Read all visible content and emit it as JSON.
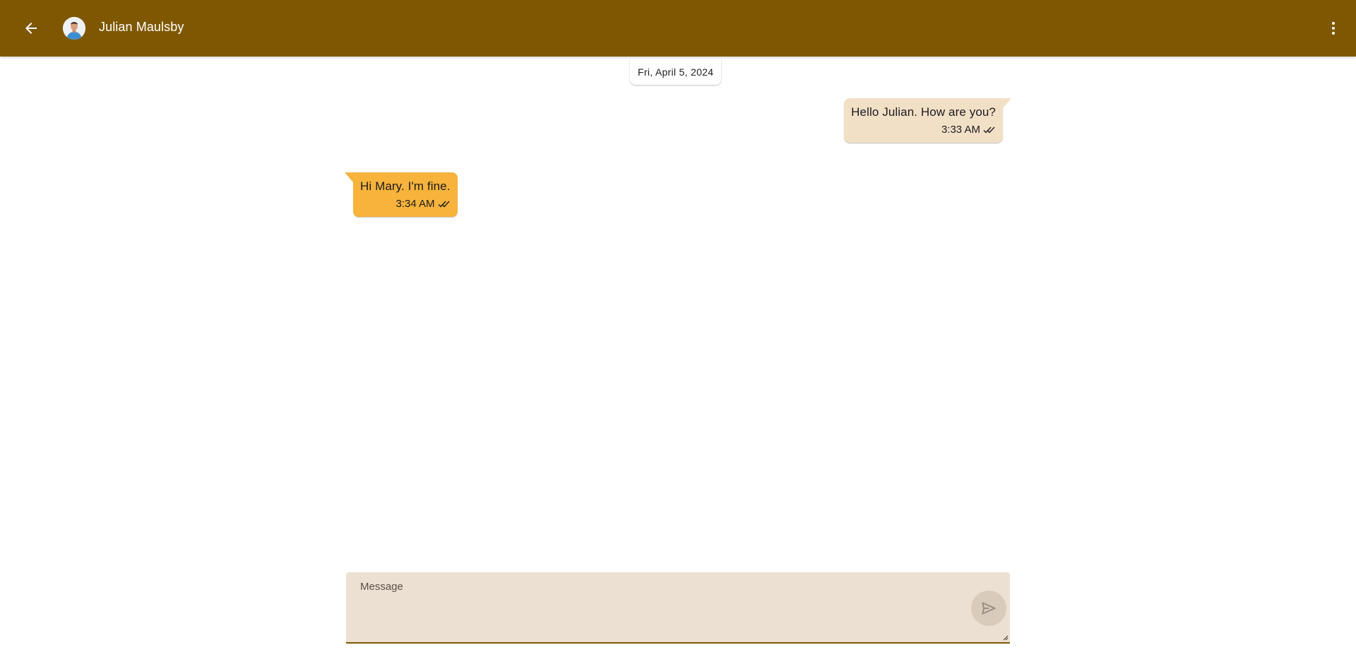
{
  "header": {
    "back_icon": "arrow-back-icon",
    "contact_name": "Julian Maulsby",
    "avatar_icon": "contact-avatar",
    "menu_icon": "more-vert-icon",
    "background_color": "#7f5700"
  },
  "conversation": {
    "date_divider": "Fri, April 5, 2024",
    "messages": [
      {
        "direction": "sent",
        "text": "Hello Julian. How are you?",
        "time": "3:33 AM",
        "status_icon": "double-check-icon",
        "bubble_color": "#f2e0c6"
      },
      {
        "direction": "received",
        "text": "Hi Mary. I'm fine.",
        "time": "3:34 AM",
        "status_icon": "double-check-icon",
        "bubble_color": "#f7b33b"
      }
    ]
  },
  "composer": {
    "placeholder": "Message",
    "value": "",
    "send_icon": "send-icon"
  }
}
